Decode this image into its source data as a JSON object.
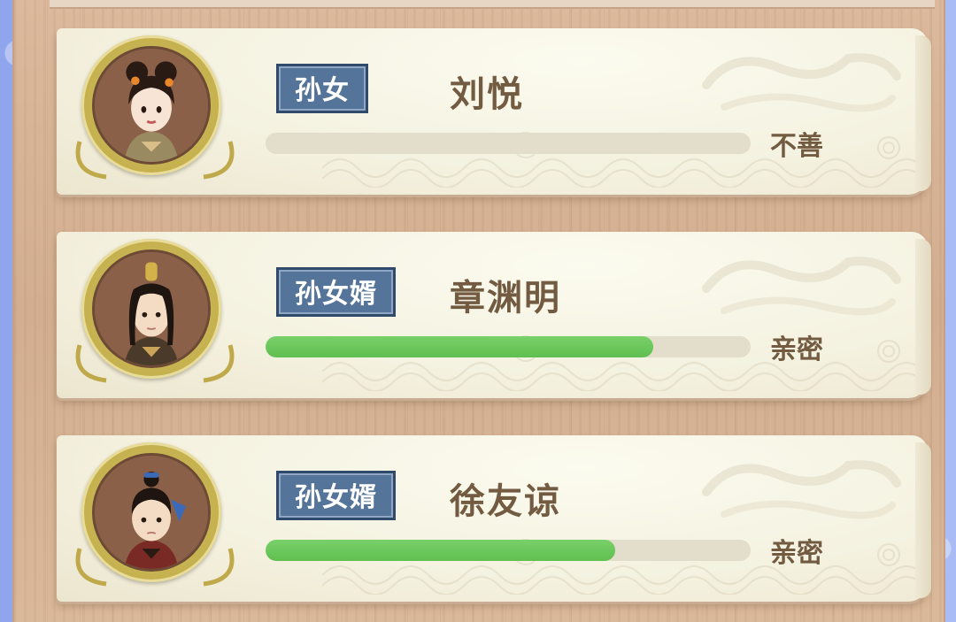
{
  "relatives": [
    {
      "relation": "孙女",
      "name": "刘悦",
      "status": "不善",
      "affinity": 0.0,
      "avatar_icon": "female-character-avatar-icon"
    },
    {
      "relation": "孙女婿",
      "name": "章渊明",
      "status": "亲密",
      "affinity": 0.8,
      "avatar_icon": "male-character-avatar-icon"
    },
    {
      "relation": "孙女婿",
      "name": "徐友谅",
      "status": "亲密",
      "affinity": 0.72,
      "avatar_icon": "male-character-avatar-icon"
    }
  ],
  "colors": {
    "affinity_bar": "#6cc95b",
    "tag_background": "#55749a",
    "name_text": "#735b42"
  }
}
